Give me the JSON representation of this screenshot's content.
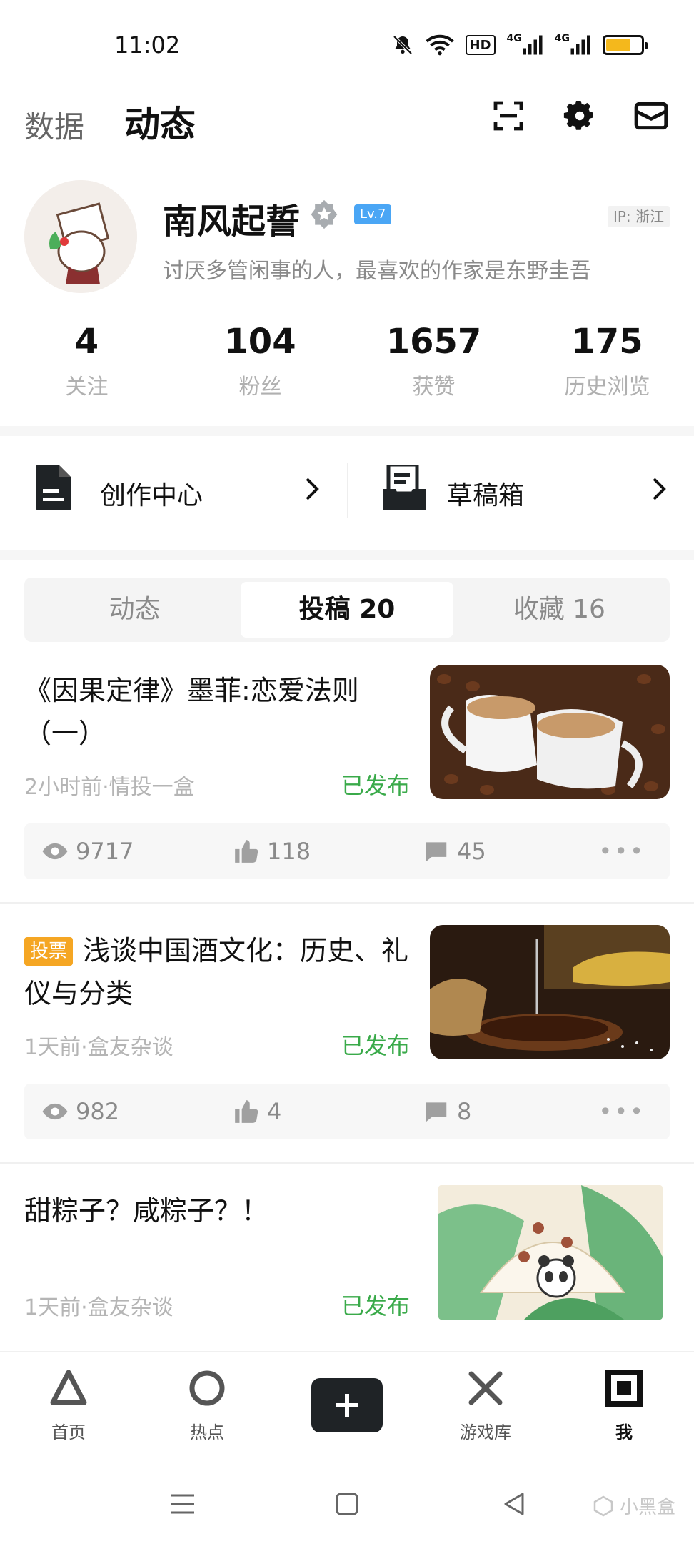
{
  "status_bar": {
    "time": "11:02",
    "hd_label": "HD",
    "net1": "4G",
    "net2": "4G",
    "battery_level": 0.7
  },
  "top_nav": {
    "data_label": "数据",
    "dynamic_label": "动态"
  },
  "profile": {
    "name": "南风起誓",
    "level": "Lv.7",
    "ip": "IP: 浙江",
    "bio": "讨厌多管闲事的人，最喜欢的作家是东野圭吾"
  },
  "stats": [
    {
      "value": "4",
      "label": "关注"
    },
    {
      "value": "104",
      "label": "粉丝"
    },
    {
      "value": "1657",
      "label": "获赞"
    },
    {
      "value": "175",
      "label": "历史浏览"
    }
  ],
  "shortcuts": [
    {
      "label": "创作中心",
      "icon": "document-icon"
    },
    {
      "label": "草稿箱",
      "icon": "drafts-icon"
    }
  ],
  "tabs": [
    {
      "label": "动态",
      "active": false
    },
    {
      "label": "投稿 20",
      "active": true
    },
    {
      "label": "收藏 16",
      "active": false
    }
  ],
  "posts": [
    {
      "title": "《因果定律》墨菲:恋爱法则（一）",
      "tag": "",
      "meta": "2小时前·情投一盒",
      "status": "已发布",
      "views": "9717",
      "likes": "118",
      "comments": "45",
      "thumb": "heart-coffee-cups"
    },
    {
      "title": "浅谈中国酒文化：历史、礼仪与分类",
      "tag": "投票",
      "meta": "1天前·盒友杂谈",
      "status": "已发布",
      "views": "982",
      "likes": "4",
      "comments": "8",
      "thumb": "wine-pouring"
    },
    {
      "title": "甜粽子？咸粽子？！",
      "tag": "",
      "meta": "1天前·盒友杂谈",
      "status": "已发布",
      "thumb": "zongzi-illustration"
    }
  ],
  "bottom_nav": [
    {
      "label": "首页",
      "icon": "triangle-icon",
      "active": false
    },
    {
      "label": "热点",
      "icon": "circle-icon",
      "active": false
    },
    {
      "label": "游戏库",
      "icon": "cross-icon",
      "active": false
    },
    {
      "label": "我",
      "icon": "square-icon",
      "active": true
    }
  ],
  "watermark": "小黑盒",
  "colors": {
    "accent_green": "#3aaa4a",
    "level_blue": "#4aa6f5",
    "vote_orange": "#f5a623",
    "battery_yellow": "#f4b81c"
  }
}
